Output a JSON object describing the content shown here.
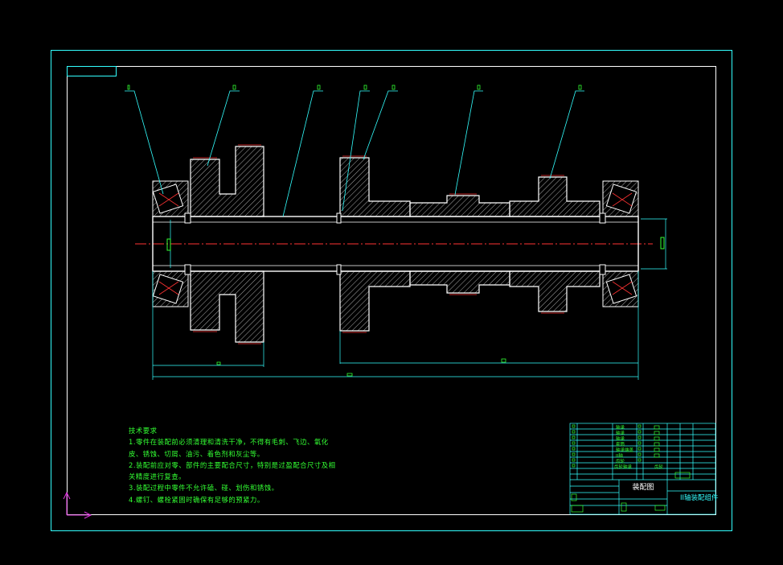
{
  "drawing": {
    "title": "装配图",
    "part_name": "II轴装配组件",
    "colors": {
      "background": "#000000",
      "frame": "#33ffff",
      "inner_frame": "#ffffff",
      "text": "#33ff33",
      "center_line": "#ff3333",
      "part_outline": "#ffffff",
      "hatch": "#cccccc"
    }
  },
  "tech_requirements": {
    "heading": "技术要求",
    "items": [
      "1.零件在装配前必须清理和清洗干净，不得有毛刺、飞边、氧化",
      "皮、锈蚀、切屑、油污、着色剂和灰尘等。",
      "2.装配前应对零、部件的主要配合尺寸，特别是过盈配合尺寸及相",
      "关精度进行复查。",
      "3.装配过程中零件不允许磕、碰、划伤和锈蚀。",
      "4.螺钉、螺栓紧固时确保有足够的预紧力。"
    ]
  },
  "bom": {
    "rows": [
      "轴承",
      "轴承",
      "轴承",
      "套筒",
      "轴承端盖",
      "II轴",
      "齿轮",
      "齿轮轴承"
    ],
    "last_label": "齿轮",
    "extra": "齿轮"
  },
  "ucs_icon": "ucs-axis-icon"
}
